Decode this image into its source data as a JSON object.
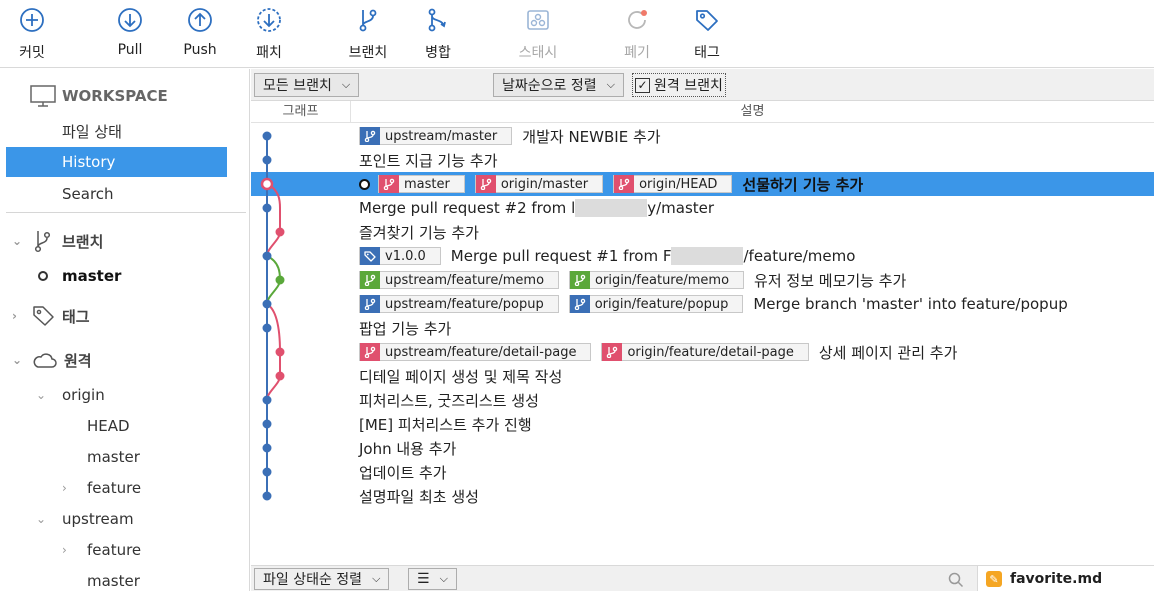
{
  "toolbar": {
    "commit": "커밋",
    "pull": "Pull",
    "push": "Push",
    "fetch": "패치",
    "branch": "브랜치",
    "merge": "병합",
    "stash": "스태시",
    "discard": "폐기",
    "tag": "태그"
  },
  "sidebar": {
    "workspace": "WORKSPACE",
    "file_status": "파일 상태",
    "history": "History",
    "search": "Search",
    "branches": "브랜치",
    "branch_master": "master",
    "tags": "태그",
    "remotes": "원격",
    "origin": "origin",
    "origin_head": "HEAD",
    "origin_master": "master",
    "origin_feature": "feature",
    "upstream": "upstream",
    "upstream_feature": "feature",
    "upstream_master": "master"
  },
  "filter": {
    "all_branches": "모든 브랜치",
    "remote_branches": "원격 브랜치",
    "sort_by_date": "날짜순으로 정렬"
  },
  "columns": {
    "graph": "그래프",
    "description": "설명"
  },
  "commits": [
    {
      "tags": [
        {
          "label": "upstream/master",
          "kind": "branch",
          "color": "#3b6fb6"
        }
      ],
      "message": "개발자 NEWBIE 추가"
    },
    {
      "tags": [],
      "message": "포인트 지급 기능 추가"
    },
    {
      "tags": [
        {
          "label": "master",
          "kind": "branch",
          "color": "#e0506e"
        },
        {
          "label": "origin/master",
          "kind": "branch",
          "color": "#e0506e"
        },
        {
          "label": "origin/HEAD",
          "kind": "branch",
          "color": "#e0506e"
        }
      ],
      "message": "선물하기 기능 추가"
    },
    {
      "tags": [],
      "message": "Merge pull request #2 from l",
      "message_tail": "y/master"
    },
    {
      "tags": [],
      "message": "즐겨찾기 기능 추가"
    },
    {
      "tags": [
        {
          "label": "v1.0.0",
          "kind": "tag",
          "color": "#3b6fb6"
        }
      ],
      "message": "Merge pull request #1 from F",
      "message_tail": "/feature/memo"
    },
    {
      "tags": [
        {
          "label": "upstream/feature/memo",
          "kind": "branch",
          "color": "#5aa83a"
        },
        {
          "label": "origin/feature/memo",
          "kind": "branch",
          "color": "#5aa83a"
        }
      ],
      "message": "유저 정보 메모기능 추가"
    },
    {
      "tags": [
        {
          "label": "upstream/feature/popup",
          "kind": "branch",
          "color": "#3b6fb6"
        },
        {
          "label": "origin/feature/popup",
          "kind": "branch",
          "color": "#3b6fb6"
        }
      ],
      "message": "Merge branch 'master' into feature/popup"
    },
    {
      "tags": [],
      "message": "팝업 기능 추가"
    },
    {
      "tags": [
        {
          "label": "upstream/feature/detail-page",
          "kind": "branch",
          "color": "#e0506e"
        },
        {
          "label": "origin/feature/detail-page",
          "kind": "branch",
          "color": "#e0506e"
        }
      ],
      "message": "상세 페이지 관리 추가"
    },
    {
      "tags": [],
      "message": "디테일 페이지 생성 및 제목 작성"
    },
    {
      "tags": [],
      "message": "피처리스트, 굿즈리스트 생성"
    },
    {
      "tags": [],
      "message": "[ME] 피처리스트 추가 진행"
    },
    {
      "tags": [],
      "message": "John 내용 추가"
    },
    {
      "tags": [],
      "message": "업데이트 추가"
    },
    {
      "tags": [],
      "message": "설명파일 최초 생성"
    }
  ],
  "bottom": {
    "sort_file_status": "파일 상태순 정렬",
    "file_name": "favorite.md"
  },
  "colors": {
    "accent": "#3b96e8",
    "lane_blue": "#3b6fb6",
    "lane_pink": "#e0506e",
    "lane_green": "#5aa83a"
  }
}
